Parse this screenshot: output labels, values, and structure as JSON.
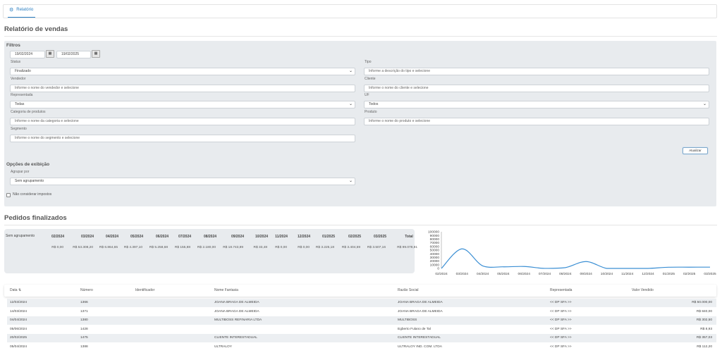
{
  "tab": {
    "icon": "gear-icon",
    "label": "Relatório"
  },
  "page_title": "Relatório de vendas",
  "filters": {
    "title": "Filtros",
    "date_from": "19/02/2024",
    "date_to": "19/02/2025",
    "date_icon": "calendar-icon",
    "status": {
      "label": "Status",
      "value": "Finalizado"
    },
    "tipo": {
      "label": "Tipo",
      "placeholder": "Informe a descrição do tipo e selecione"
    },
    "vendedor": {
      "label": "Vendedor",
      "placeholder": "Informe o nome do vendedor e selecione"
    },
    "cliente": {
      "label": "Cliente",
      "placeholder": "Informe o nome do cliente e selecione"
    },
    "representada": {
      "label": "Representada",
      "value": "Todas"
    },
    "uf": {
      "label": "UF",
      "value": "Todos"
    },
    "categoria": {
      "label": "Categoria de produtos",
      "placeholder": "Informe o nome da categoria e selecione"
    },
    "produto": {
      "label": "Produto",
      "placeholder": "Informe o nome do produto e selecione"
    },
    "segmento": {
      "label": "Segmento",
      "placeholder": "Informe o nome do segmento e selecione"
    },
    "atualizar_label": "Atualizar"
  },
  "display_options": {
    "title": "Opções de exibição",
    "group_label": "Agrupar por",
    "group_value": "Sem agrupamento",
    "checkbox_label": "Não considerar impostos"
  },
  "orders_title": "Pedidos finalizados",
  "summary": {
    "row_label": "Sem agrupamento",
    "columns": [
      "02/2024",
      "03/2024",
      "04/2024",
      "05/2024",
      "06/2024",
      "07/2024",
      "08/2024",
      "09/2024",
      "10/2024",
      "11/2024",
      "12/2024",
      "01/2025",
      "02/2025",
      "03/2025",
      "Total"
    ],
    "values": [
      "R$ 0,00",
      "R$ 53.308,20",
      "R$ 6.864,65",
      "R$ 4.397,10",
      "R$ 5.258,68",
      "R$ 155,88",
      "R$ 2.180,00",
      "R$ 18.743,89",
      "R$ 33,48",
      "R$ 0,00",
      "R$ 0,00",
      "R$ 3.225,18",
      "R$ 3.404,59",
      "R$ 3.507,16",
      "R$ 99.078,81"
    ]
  },
  "chart_data": {
    "type": "line",
    "x": [
      "02/2024",
      "03/2024",
      "04/2024",
      "05/2024",
      "06/2024",
      "07/2024",
      "08/2024",
      "09/2024",
      "10/2024",
      "11/2024",
      "12/2024",
      "01/2025",
      "02/2025",
      "03/2025"
    ],
    "series": [
      {
        "values": [
          0,
          53308.2,
          6864.65,
          4397.1,
          5258.68,
          155.88,
          2180,
          18743.89,
          33.48,
          0,
          0,
          3225.18,
          3404.59,
          3507.16
        ]
      }
    ],
    "yticks": [
      "0",
      "10000",
      "20000",
      "30000",
      "40000",
      "50000",
      "60000",
      "70000",
      "80000",
      "90000",
      "100000"
    ],
    "ylim": [
      0,
      100000
    ],
    "color": "#3b8fd4"
  },
  "table": {
    "headers": [
      "Data",
      "Número",
      "Identificador",
      "Nome Fantasia",
      "Razão Social",
      "Representada",
      "Valor Vendido"
    ],
    "sort_icon": "sort-icon",
    "rows": [
      {
        "data": "12/03/2024",
        "numero": "1366",
        "identificador": "",
        "fantasia": "JOANA BRAGA DE ALMEIDA",
        "razao": "JOANA BRAGA DE ALMEIDA",
        "representada": "<< DP SFA >>",
        "valor": "R$ 50.000,00"
      },
      {
        "data": "14/03/2024",
        "numero": "1371",
        "identificador": "",
        "fantasia": "JOANA BRAGA DE ALMEIDA",
        "razao": "JOANA BRAGA DE ALMEIDA",
        "representada": "<< DP SFA >>",
        "valor": "R$ 840,00"
      },
      {
        "data": "04/04/2024",
        "numero": "1380",
        "identificador": "",
        "fantasia": "MULTIBOSS REFINARIA LTDA",
        "razao": "MULTIBOSS",
        "representada": "<< DP SFA >>",
        "valor": "R$ 302,50"
      },
      {
        "data": "05/06/2024",
        "numero": "1428",
        "identificador": "",
        "fantasia": "",
        "razao": "Egberto Fulano de Tal",
        "representada": "<< DP SFA >>",
        "valor": "R$ 8,93"
      },
      {
        "data": "20/02/2025",
        "numero": "1475",
        "identificador": "",
        "fantasia": "CLIENTE INTERESTADUAL",
        "razao": "CLIENTE INTERESTADUAL",
        "representada": "<< DP SFA >>",
        "valor": "R$ 357,03"
      },
      {
        "data": "05/04/2024",
        "numero": "1388",
        "identificador": "",
        "fantasia": "ULTRALOY",
        "razao": "ULTRALOY IND. COM. LTDA",
        "representada": "<< DP SFA >>",
        "valor": "R$ 112,20"
      }
    ]
  }
}
